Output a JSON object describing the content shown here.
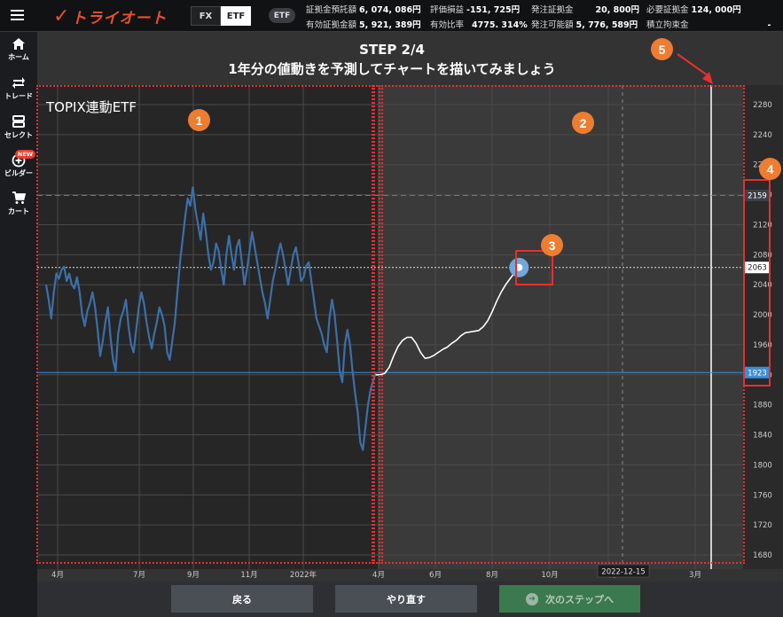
{
  "header": {
    "logo_text": "トライオート",
    "mode_fx": "FX",
    "mode_etf": "ETF",
    "etf_pill": "ETF",
    "account": [
      {
        "label": "証拠金預託額",
        "value": "6, 074, 086円"
      },
      {
        "label": "評価損益",
        "value": "-151, 725円"
      },
      {
        "label": "発注証拠金",
        "value": "20, 800円"
      },
      {
        "label": "必要証拠金",
        "value": "124, 000円"
      },
      {
        "label": "有効証拠金額",
        "value": "5, 921, 389円"
      },
      {
        "label": "有効比率",
        "value": "4775. 314%"
      },
      {
        "label": "発注可能額",
        "value": "5, 776, 589円"
      },
      {
        "label": "積立拘束金",
        "value": "-"
      }
    ]
  },
  "sidenav": [
    {
      "label": "ホーム",
      "icon": "home-icon"
    },
    {
      "label": "トレード",
      "icon": "trade-icon"
    },
    {
      "label": "セレクト",
      "icon": "select-icon"
    },
    {
      "label": "ビルダー",
      "icon": "builder-icon",
      "badge": "NEW"
    },
    {
      "label": "カート",
      "icon": "cart-icon"
    }
  ],
  "title": {
    "step": "STEP 2/4",
    "instruction": "1年分の値動きを予測してチャートを描いてみましょう"
  },
  "chart_data": {
    "type": "line",
    "title": "TOPIX連動ETF",
    "ylim": [
      1660,
      2300
    ],
    "y_ticks": [
      2280,
      2240,
      2200,
      2160,
      2120,
      2080,
      2040,
      2000,
      1960,
      1920,
      1880,
      1840,
      1800,
      1760,
      1720,
      1680
    ],
    "x_tick_labels": [
      "4月",
      "7月",
      "9月",
      "11月",
      "2022年",
      "4月",
      "6月",
      "8月",
      "10月",
      "12月",
      "3月"
    ],
    "x_date_marker": "2022-12-15",
    "price_tags": [
      {
        "value": 2159,
        "label": "2159",
        "color": "#3d4047"
      },
      {
        "value": 2063,
        "label": "2063",
        "color": "#ffffff"
      },
      {
        "value": 1923,
        "label": "1923",
        "color": "#3b8fd9"
      }
    ],
    "series": [
      {
        "role": "historical",
        "color": "#3c6fa8",
        "values": [
          2040,
          2020,
          1995,
          2030,
          2055,
          2048,
          2060,
          2064,
          2045,
          2055,
          2040,
          2035,
          2050,
          2030,
          2000,
          1985,
          2005,
          2015,
          2030,
          2010,
          1980,
          1945,
          1965,
          1990,
          2010,
          1970,
          1940,
          1925,
          1975,
          1995,
          2005,
          2020,
          1985,
          1960,
          1950,
          1980,
          2010,
          2030,
          2015,
          1990,
          1970,
          1955,
          1975,
          1990,
          2010,
          2000,
          1985,
          1950,
          1940,
          1965,
          1990,
          2030,
          2070,
          2100,
          2130,
          2155,
          2145,
          2170,
          2140,
          2120,
          2100,
          2135,
          2110,
          2080,
          2060,
          2070,
          2095,
          2085,
          2060,
          2040,
          2080,
          2105,
          2080,
          2060,
          2090,
          2100,
          2070,
          2040,
          2060,
          2085,
          2110,
          2090,
          2070,
          2050,
          2030,
          2015,
          1995,
          2020,
          2045,
          2060,
          2080,
          2095,
          2080,
          2060,
          2040,
          2060,
          2080,
          2090,
          2070,
          2045,
          2050,
          2065,
          2070,
          2045,
          2020,
          1995,
          1985,
          1975,
          1960,
          1950,
          1995,
          2020,
          2000,
          1965,
          1925,
          1910,
          1960,
          1980,
          1960,
          1925,
          1895,
          1870,
          1830,
          1820,
          1850,
          1880,
          1900,
          1912,
          1923
        ],
        "x_start": 0.0,
        "x_end": 0.467
      },
      {
        "role": "user-prediction",
        "color": "#ffffff",
        "values": [
          1920,
          1920,
          1922,
          1930,
          1945,
          1958,
          1966,
          1970,
          1970,
          1962,
          1950,
          1942,
          1943,
          1946,
          1950,
          1954,
          1957,
          1962,
          1966,
          1972,
          1976,
          1977,
          1978,
          1979,
          1984,
          1992,
          2004,
          2018,
          2030,
          2040,
          2048,
          2056,
          2063
        ],
        "x_start": 0.467,
        "x_end": 0.67
      }
    ]
  },
  "buttons": {
    "back": "戻る",
    "redo": "やり直す",
    "next": "次のステップへ"
  },
  "annotations": [
    "1",
    "2",
    "3",
    "4",
    "5"
  ]
}
